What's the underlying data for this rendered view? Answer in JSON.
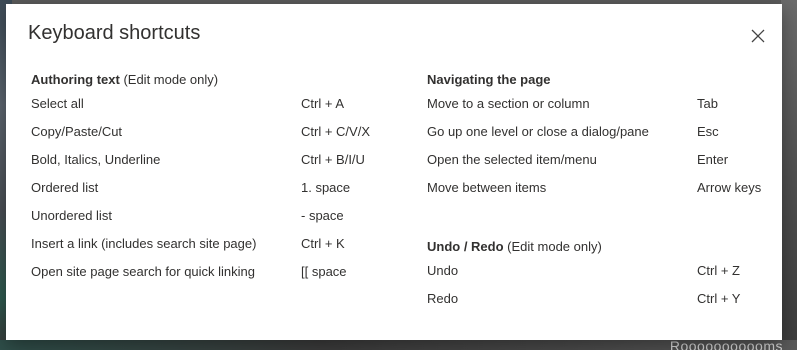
{
  "dialog": {
    "title": "Keyboard shortcuts",
    "close_icon": "close-icon"
  },
  "authoring": {
    "title": "Authoring text",
    "subtitle": "(Edit mode only)",
    "rows": [
      {
        "desc": "Select all",
        "key": "Ctrl + A"
      },
      {
        "desc": "Copy/Paste/Cut",
        "key": "Ctrl + C/V/X"
      },
      {
        "desc": "Bold, Italics, Underline",
        "key": "Ctrl + B/I/U"
      },
      {
        "desc": "Ordered list",
        "key": "1. space"
      },
      {
        "desc": "Unordered list",
        "key": "- space"
      },
      {
        "desc": "Insert a link (includes search site page)",
        "key": "Ctrl + K"
      },
      {
        "desc": "Open site page search for quick linking",
        "key": "[[ space"
      }
    ]
  },
  "navigating": {
    "title": "Navigating the page",
    "rows": [
      {
        "desc": "Move to a section or column",
        "key": "Tab"
      },
      {
        "desc": "Go up one level or close a dialog/pane",
        "key": "Esc"
      },
      {
        "desc": "Open the selected item/menu",
        "key": "Enter"
      },
      {
        "desc": "Move between items",
        "key": "Arrow keys"
      }
    ]
  },
  "undo_redo": {
    "title": "Undo / Redo",
    "subtitle": "(Edit mode only)",
    "rows": [
      {
        "desc": "Undo",
        "key": "Ctrl + Z"
      },
      {
        "desc": "Redo",
        "key": "Ctrl + Y"
      }
    ]
  },
  "background": {
    "corner_text": "Rooooooooooms"
  }
}
